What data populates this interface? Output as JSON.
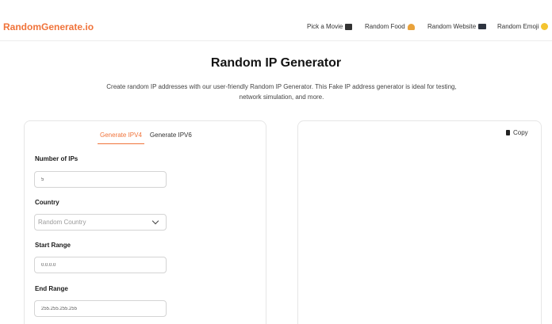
{
  "brand": "RandomGenerate.io",
  "nav": [
    {
      "label": "Pick a Movie",
      "icon": "clapperboard-icon"
    },
    {
      "label": "Random Food",
      "icon": "burger-icon"
    },
    {
      "label": "Random Website",
      "icon": "laptop-icon"
    },
    {
      "label": "Random Emoji",
      "icon": "smiley-icon"
    }
  ],
  "page": {
    "title": "Random IP Generator",
    "description": "Create random IP addresses with our user-friendly Random IP Generator. This Fake IP address generator is ideal for testing, network simulation, and more."
  },
  "tabs": [
    {
      "label": "Generate IPV4",
      "active": true
    },
    {
      "label": "Generate IPV6",
      "active": false
    }
  ],
  "form": {
    "count_label": "Number of IPs",
    "count_value": "5",
    "country_label": "Country",
    "country_value": "Random Country",
    "start_label": "Start Range",
    "start_value": "0.0.0.0",
    "end_label": "End Range",
    "end_value": "255.255.255.255"
  },
  "output": {
    "copy_label": "Copy"
  },
  "colors": {
    "accent": "#f0733a"
  }
}
